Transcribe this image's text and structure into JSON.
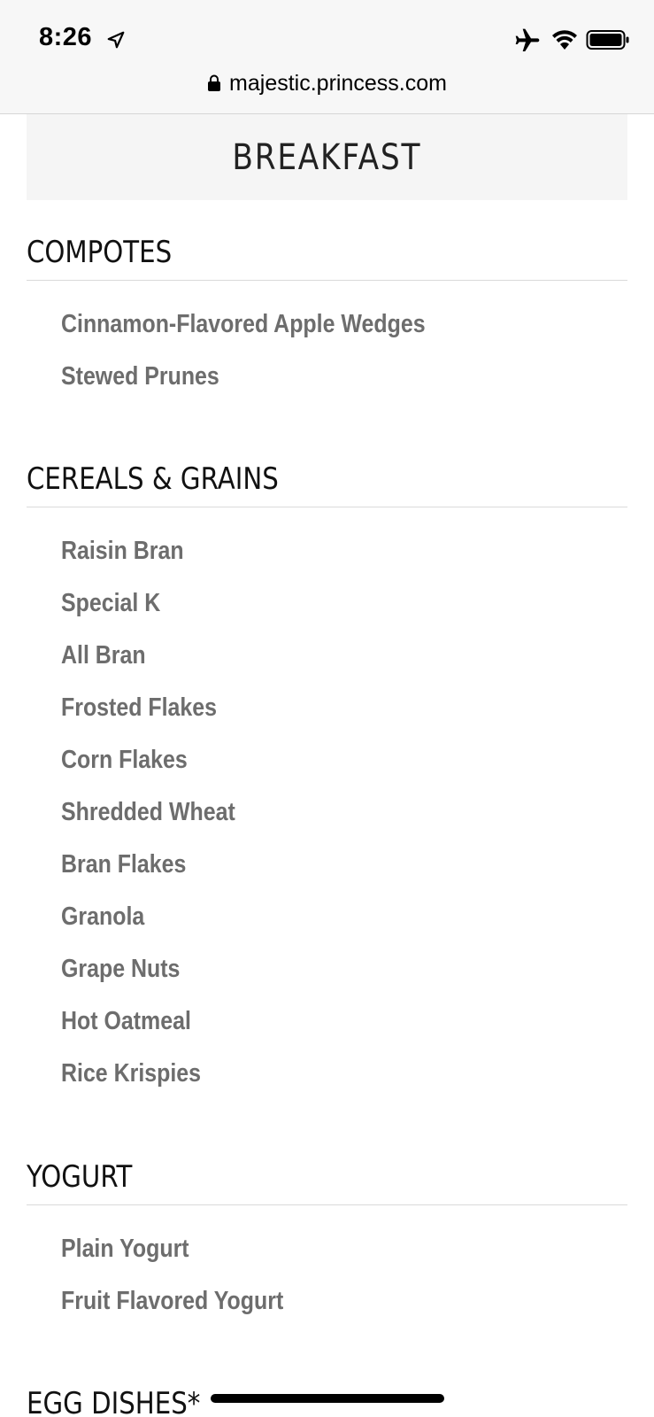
{
  "status_bar": {
    "time": "8:26",
    "icons": [
      "location-arrow-icon",
      "airplane-icon",
      "wifi-icon",
      "battery-icon"
    ]
  },
  "browser": {
    "url": "majestic.princess.com",
    "secure_icon": "lock-icon"
  },
  "menu": {
    "meal_title": "BREAKFAST",
    "sections": [
      {
        "title": "COMPOTES",
        "items": [
          "Cinnamon-Flavored Apple Wedges",
          "Stewed Prunes"
        ]
      },
      {
        "title": "CEREALS & GRAINS",
        "items": [
          "Raisin Bran",
          "Special K",
          "All Bran",
          "Frosted Flakes",
          "Corn Flakes",
          "Shredded Wheat",
          "Bran Flakes",
          "Granola",
          "Grape Nuts",
          "Hot Oatmeal",
          "Rice Krispies"
        ]
      },
      {
        "title": "YOGURT",
        "items": [
          "Plain Yogurt",
          "Fruit Flavored Yogurt"
        ]
      },
      {
        "title": "EGG DISHES*",
        "items": []
      }
    ]
  },
  "colors": {
    "item_text": "#6d6d6d",
    "heading_text": "#111111",
    "header_bg": "#f5f5f5",
    "status_bg": "#f7f7f7"
  }
}
